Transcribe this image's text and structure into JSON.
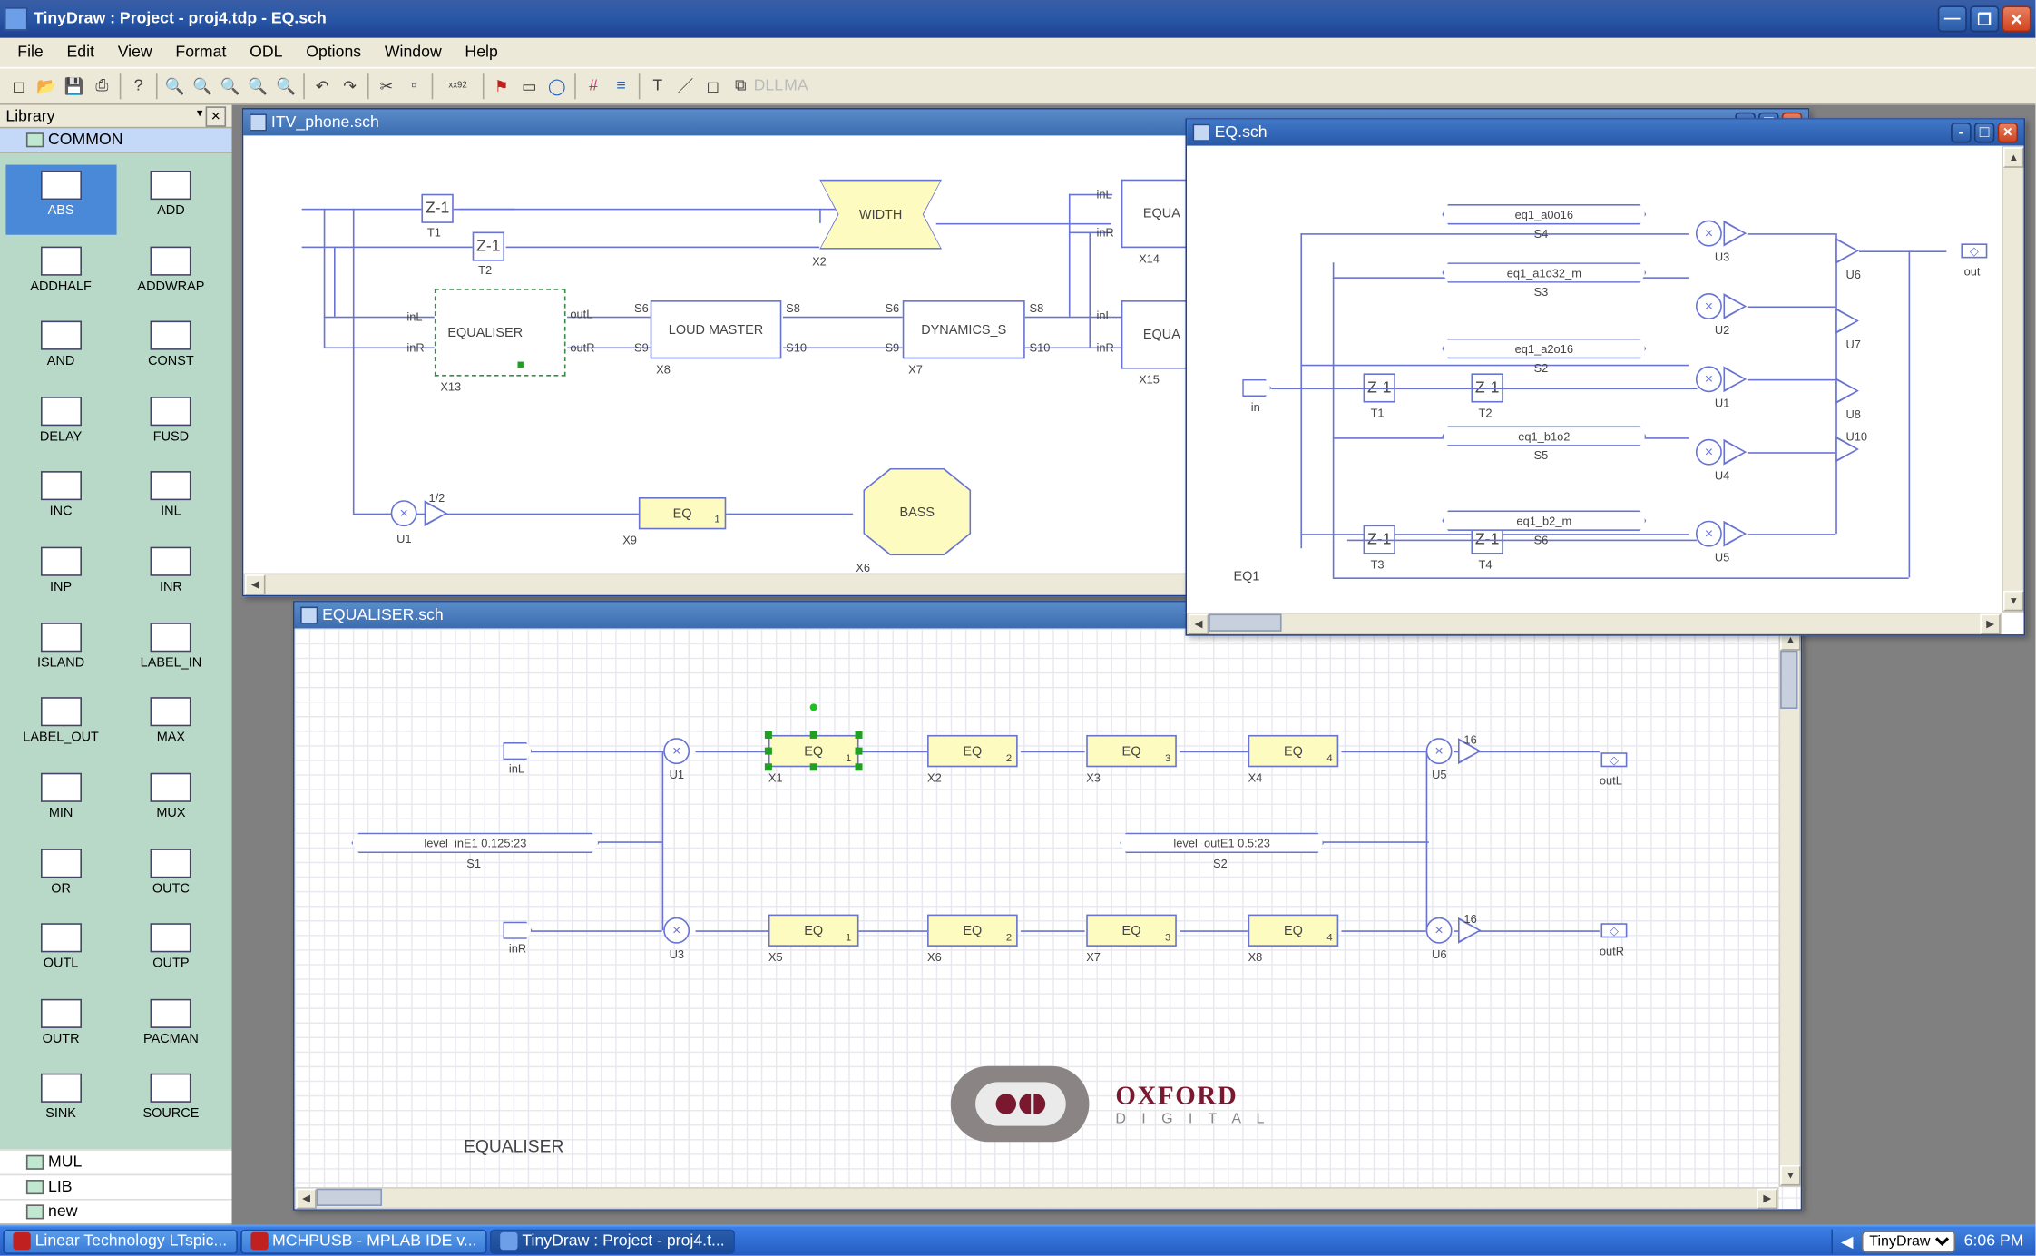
{
  "app": {
    "title": "TinyDraw : Project - proj4.tdp - EQ.sch"
  },
  "menu": [
    "File",
    "Edit",
    "View",
    "Format",
    "ODL",
    "Options",
    "Window",
    "Help"
  ],
  "library": {
    "title": "Library",
    "top_tree": [
      "COMMON"
    ],
    "palette": [
      {
        "l": "ABS",
        "sel": true
      },
      {
        "l": "ADD"
      },
      {
        "l": "ADDHALF"
      },
      {
        "l": "ADDWRAP"
      },
      {
        "l": "AND"
      },
      {
        "l": "CONST"
      },
      {
        "l": "DELAY"
      },
      {
        "l": "FUSD"
      },
      {
        "l": "INC"
      },
      {
        "l": "INL"
      },
      {
        "l": "INP"
      },
      {
        "l": "INR"
      },
      {
        "l": "ISLAND"
      },
      {
        "l": "LABEL_IN"
      },
      {
        "l": "LABEL_OUT"
      },
      {
        "l": "MAX"
      },
      {
        "l": "MIN"
      },
      {
        "l": "MUX"
      },
      {
        "l": "OR"
      },
      {
        "l": "OUTC"
      },
      {
        "l": "OUTL"
      },
      {
        "l": "OUTP"
      },
      {
        "l": "OUTR"
      },
      {
        "l": "PACMAN"
      },
      {
        "l": "SINK"
      },
      {
        "l": "SOURCE"
      }
    ],
    "bottom_tree": [
      "MUL",
      "LIB",
      "new"
    ]
  },
  "win_itv": {
    "title": "ITV_phone.sch",
    "blocks": {
      "t1": "T1",
      "t2": "T2",
      "equaliser": "EQUALISER",
      "x13": "X13",
      "loudmaster": "LOUD MASTER",
      "x8": "X8",
      "dynamics": "DYNAMICS_S",
      "x7": "X7",
      "width": "WIDTH",
      "x2": "X2",
      "bass": "BASS",
      "x6": "X6",
      "eq": "EQ",
      "x9": "X9",
      "u1": "U1",
      "x14": "X14",
      "x15": "X15",
      "inL": "inL",
      "inR": "inR",
      "outL": "outL",
      "outR": "outR",
      "s6": "S6",
      "s8": "S8",
      "s9": "S9",
      "s10": "S10",
      "equa": "EQUA",
      "half": "1/2",
      "z": "Z"
    }
  },
  "win_eq": {
    "title": "EQ.sch",
    "labels": {
      "s2": "eq1_a2o16",
      "s3": "eq1_a1o32_m",
      "s4": "eq1_a0o16",
      "s5": "eq1_b1o2",
      "s6": "eq1_b2_m",
      "in": "in",
      "out": "out",
      "eq1": "EQ1",
      "s2l": "S2",
      "s3l": "S3",
      "s4l": "S4",
      "s5l": "S5",
      "s6l": "S6",
      "t1": "T1",
      "t2": "T2",
      "t3": "T3",
      "t4": "T4",
      "u1": "U1",
      "u2": "U2",
      "u3": "U3",
      "u4": "U4",
      "u5": "U5",
      "u6": "U6",
      "u7": "U7",
      "u8": "U8",
      "u10": "U10",
      "z": "Z"
    }
  },
  "win_equaliser": {
    "title": "EQUALISER.sch",
    "labels": {
      "title": "EQUALISER",
      "inL": "inL",
      "inR": "inR",
      "outL": "outL",
      "outR": "outR",
      "u1": "U1",
      "u3": "U3",
      "u5": "U5",
      "u6": "U6",
      "x1": "X1",
      "x2": "X2",
      "x3": "X3",
      "x4": "X4",
      "x5": "X5",
      "x6": "X6",
      "x7": "X7",
      "x8": "X8",
      "s1": "S1",
      "s2": "S2",
      "eq": "EQ",
      "sixteen": "16",
      "level_in": "level_inE1 0.125:23",
      "level_out": "level_outE1 0.5:23"
    }
  },
  "logo": {
    "name": "OXFORD",
    "sub": "D I G I T A L"
  },
  "taskbar": {
    "items": [
      {
        "l": "Linear Technology LTspic..."
      },
      {
        "l": "MCHPUSB - MPLAB IDE v..."
      },
      {
        "l": "TinyDraw : Project - proj4.t...",
        "active": true
      }
    ],
    "tray_select": "TinyDraw",
    "clock": "6:06 PM"
  }
}
